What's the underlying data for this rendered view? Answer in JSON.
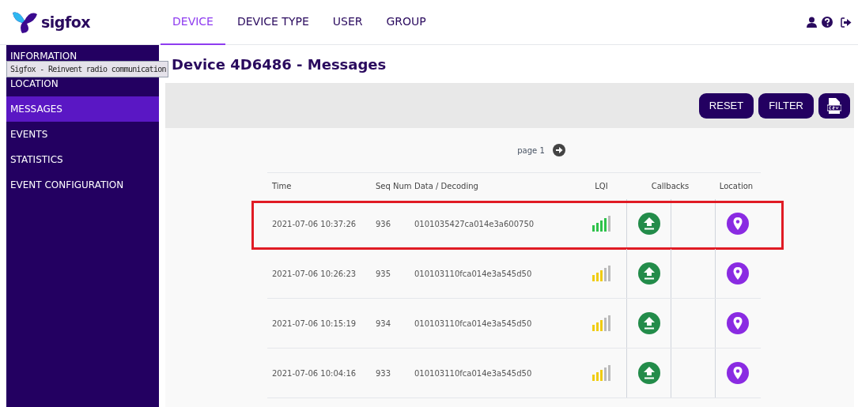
{
  "brand": {
    "name": "sigfox"
  },
  "nav": [
    {
      "label": "DEVICE",
      "selected": true
    },
    {
      "label": "DEVICE TYPE",
      "selected": false
    },
    {
      "label": "USER",
      "selected": false
    },
    {
      "label": "GROUP",
      "selected": false
    }
  ],
  "sidebar": {
    "items": [
      {
        "label": "INFORMATION",
        "selected": false
      },
      {
        "label": "LOCATION",
        "selected": false
      },
      {
        "label": "MESSAGES",
        "selected": true
      },
      {
        "label": "EVENTS",
        "selected": false
      },
      {
        "label": "STATISTICS",
        "selected": false
      },
      {
        "label": "EVENT CONFIGURATION",
        "selected": false
      }
    ]
  },
  "tooltip": "Sigfox - Reinvent radio communication",
  "title": "Device 4D6486 - Messages",
  "toolbar": {
    "buttons": [
      "RESET",
      "FILTER"
    ]
  },
  "pager": {
    "label": "page 1"
  },
  "table": {
    "columns": [
      "Time",
      "Seq Num",
      "Data / Decoding",
      "LQI",
      "Callbacks",
      "Location"
    ],
    "rows": [
      {
        "time": "2021-07-06 10:37:26",
        "seq": "936",
        "data": "0101035427ca014e3a600750",
        "level": 0.8,
        "highlighted": true
      },
      {
        "time": "2021-07-06 10:26:23",
        "seq": "935",
        "data": "010103110fca014e3a545d50",
        "level": 0.6,
        "highlighted": false
      },
      {
        "time": "2021-07-06 10:15:19",
        "seq": "934",
        "data": "010103110fca014e3a545d50",
        "level": 0.6,
        "highlighted": false
      },
      {
        "time": "2021-07-06 10:04:16",
        "seq": "933",
        "data": "010103110fca014e3a545d50",
        "level": 0.6,
        "highlighted": false
      }
    ]
  }
}
